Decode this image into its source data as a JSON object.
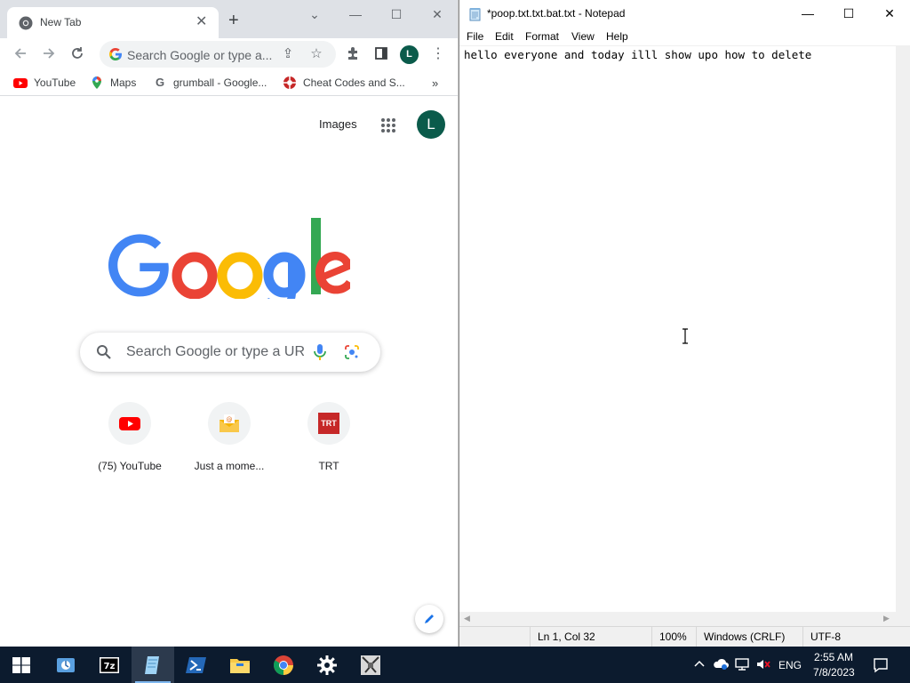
{
  "chrome": {
    "tab_title": "New Tab",
    "omnibox_placeholder": "Search Google or type a...",
    "bookmarks": [
      "YouTube",
      "Maps",
      "grumball - Google...",
      "Cheat Codes and S..."
    ],
    "images_link": "Images",
    "avatar_letter": "L",
    "search_placeholder": "Search Google or type a URL",
    "shortcuts": [
      {
        "label": "(75) YouTube"
      },
      {
        "label": "Just a mome..."
      },
      {
        "label": "TRT",
        "icon_text": "TRT"
      }
    ]
  },
  "notepad": {
    "title": "*poop.txt.txt.bat.txt - Notepad",
    "menu": [
      "File",
      "Edit",
      "Format",
      "View",
      "Help"
    ],
    "content": "hello everyone and today illl show upo how to delete",
    "status": {
      "position": "Ln 1, Col 32",
      "zoom": "100%",
      "line_ending": "Windows (CRLF)",
      "encoding": "UTF-8"
    }
  },
  "taskbar": {
    "language": "ENG",
    "time": "2:55 AM",
    "date": "7/8/2023",
    "apps": [
      "start",
      "control-panel",
      "7zip",
      "notepad",
      "powershell",
      "file-explorer",
      "chrome",
      "settings",
      "game"
    ]
  },
  "colors": {
    "google_blue": "#4285F4",
    "google_red": "#EA4335",
    "google_yellow": "#FBBC05",
    "google_green": "#34A853",
    "taskbar_bg": "#0c1b2e",
    "avatar_bg": "#0b5b4b"
  }
}
